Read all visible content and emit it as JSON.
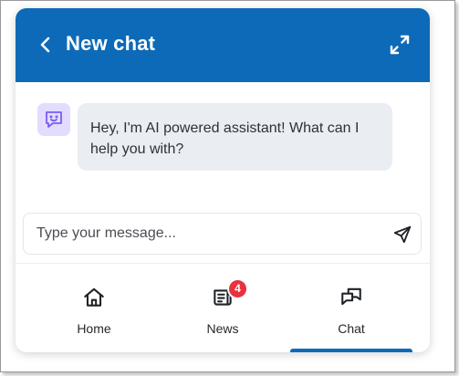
{
  "header": {
    "title": "New chat",
    "back_icon": "chevron-left-icon",
    "expand_icon": "expand-arrows-icon",
    "color": "#0d6ab8"
  },
  "messages": [
    {
      "sender": "assistant",
      "avatar_icon": "chat-bot-face-icon",
      "text": "Hey, I'm AI powered assistant! What can I help you with?"
    }
  ],
  "composer": {
    "placeholder": "Type your message...",
    "send_icon": "send-icon"
  },
  "nav": {
    "items": [
      {
        "label": "Home",
        "icon": "home-icon"
      },
      {
        "label": "News",
        "icon": "news-icon",
        "badge": "4"
      },
      {
        "label": "Chat",
        "icon": "chat-bubbles-icon",
        "active": true
      }
    ]
  },
  "colors": {
    "accent": "#0d6ab8",
    "badge": "#e6333d",
    "bubble": "#eaedf2",
    "avatar_bg": "#e3dcff"
  }
}
